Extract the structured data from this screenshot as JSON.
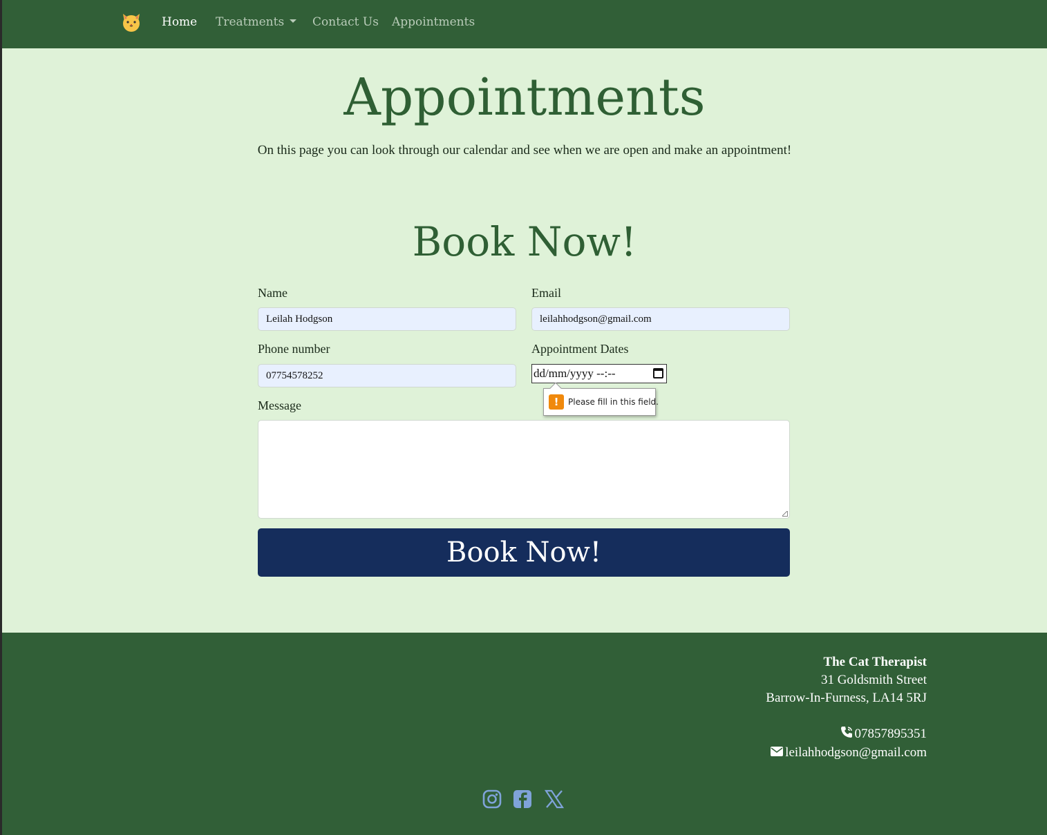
{
  "nav": {
    "brand_icon": "cat-face-icon",
    "items": [
      {
        "label": "Home",
        "active": true
      },
      {
        "label": "Treatments",
        "dropdown": true
      },
      {
        "label": "Contact Us"
      },
      {
        "label": "Appointments"
      }
    ]
  },
  "page": {
    "title": "Appointments",
    "intro": "On this page you can look through our calendar and see when we are open and make an appointment!",
    "booking_title": "Book Now!"
  },
  "form": {
    "name_label": "Name",
    "name_value": "Leilah Hodgson",
    "email_label": "Email",
    "email_value": "leilahhodgson@gmail.com",
    "phone_label": "Phone number",
    "phone_value": "07754578252",
    "dates_label": "Appointment Dates",
    "dates_placeholder": "dd/mm/yyyy --:--",
    "validation_message": "Please fill in this field.",
    "message_label": "Message",
    "message_value": "",
    "submit_label": "Book Now!"
  },
  "footer": {
    "business_name": "The Cat Therapist",
    "address_line1": "31 Goldsmith Street",
    "address_line2": "Barrow-In-Furness, LA14 5RJ",
    "phone": "07857895351",
    "email": "leilahhodgson@gmail.com",
    "social": [
      "instagram-icon",
      "facebook-icon",
      "x-twitter-icon"
    ]
  },
  "colors": {
    "nav_bg": "#315f37",
    "page_bg": "#dff2d8",
    "heading": "#2f5f34",
    "button_bg": "#152d5c",
    "social_icon": "#7fa3d9",
    "warning": "#f0890c"
  }
}
